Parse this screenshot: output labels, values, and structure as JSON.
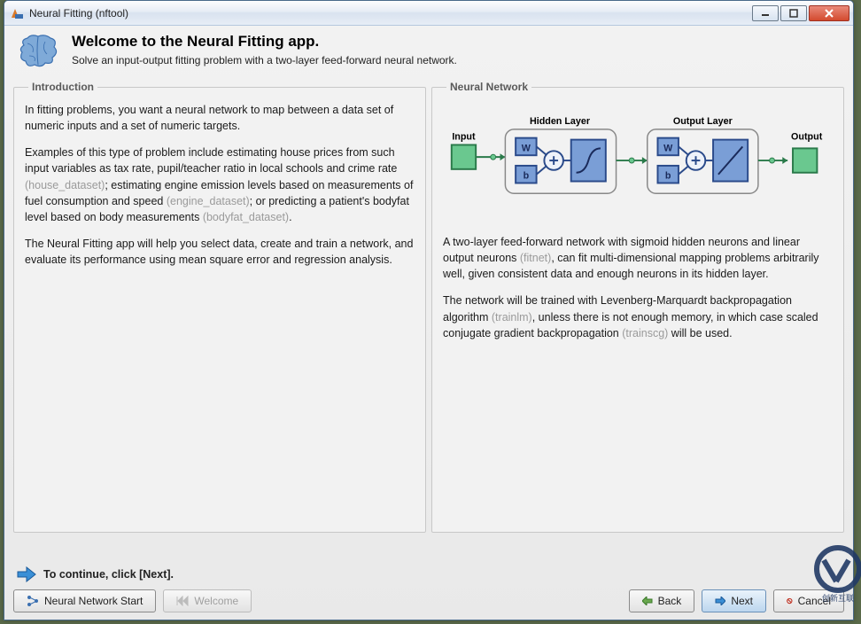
{
  "window": {
    "title": "Neural Fitting (nftool)"
  },
  "header": {
    "title": "Welcome to the Neural Fitting app.",
    "subtitle": "Solve an input-output fitting problem with a two-layer feed-forward neural network."
  },
  "panels": {
    "intro": {
      "legend": "Introduction",
      "p1": "In fitting problems, you want a neural network to map between a data set of numeric inputs and a set of numeric targets.",
      "p2a": "Examples of this type of problem include estimating house prices from such input variables as tax rate, pupil/teacher ratio in local schools and crime rate ",
      "p2link1": "(house_dataset)",
      "p2b": "; estimating engine emission levels based on measurements of fuel consumption and speed ",
      "p2link2": "(engine_dataset)",
      "p2c": "; or predicting a patient's bodyfat level based on body measurements ",
      "p2link3": "(bodyfat_dataset)",
      "p2d": ".",
      "p3": "The Neural Fitting app will help you select data, create and train a network, and evaluate its performance using mean square error and regression analysis."
    },
    "nn": {
      "legend": "Neural Network",
      "diagram": {
        "input": "Input",
        "hidden": "Hidden Layer",
        "output_layer": "Output Layer",
        "output": "Output",
        "W": "W",
        "b": "b"
      },
      "p1a": "A two-layer feed-forward network with sigmoid hidden neurons and linear output neurons ",
      "p1link": "(fitnet)",
      "p1b": ", can fit multi-dimensional mapping problems arbitrarily well, given consistent data and enough neurons in its hidden layer.",
      "p2a": "The network will be trained with Levenberg-Marquardt backpropagation algorithm ",
      "p2link1": "(trainlm)",
      "p2b": ", unless there is not enough memory, in which case scaled conjugate gradient backpropagation ",
      "p2link2": "(trainscg)",
      "p2c": " will be used."
    }
  },
  "footer": {
    "hint": "To continue, click [Next].",
    "buttons": {
      "nnstart": "Neural Network Start",
      "welcome": "Welcome",
      "back": "Back",
      "next": "Next",
      "cancel": "Cancel"
    }
  },
  "watermark": "创新互联"
}
